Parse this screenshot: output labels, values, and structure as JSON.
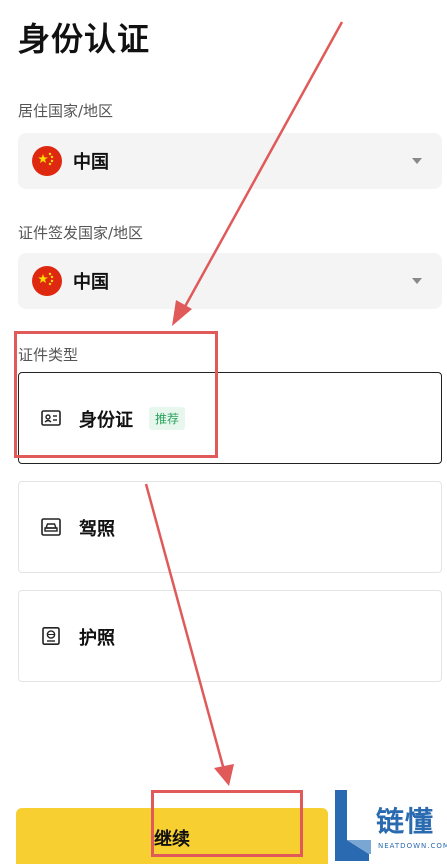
{
  "page": {
    "title": "身份认证"
  },
  "residence": {
    "label": "居住国家/地区",
    "value": "中国",
    "flag_icon": "china-flag-icon"
  },
  "issuing": {
    "label": "证件签发国家/地区",
    "value": "中国",
    "flag_icon": "china-flag-icon"
  },
  "doc_type": {
    "label": "证件类型",
    "options": [
      {
        "label": "身份证",
        "badge": "推荐",
        "icon": "id-card-icon",
        "selected": true
      },
      {
        "label": "驾照",
        "icon": "drivers-license-icon",
        "selected": false
      },
      {
        "label": "护照",
        "icon": "passport-icon",
        "selected": false
      }
    ]
  },
  "continue_label": "继续",
  "watermark": {
    "text": "链懂",
    "sub": "NEATDOWN.COM"
  },
  "colors": {
    "accent": "#f7cf31",
    "badge_green": "#2aa35c",
    "annotation_red": "#e05a5a",
    "watermark_blue": "#2a6ab0"
  }
}
